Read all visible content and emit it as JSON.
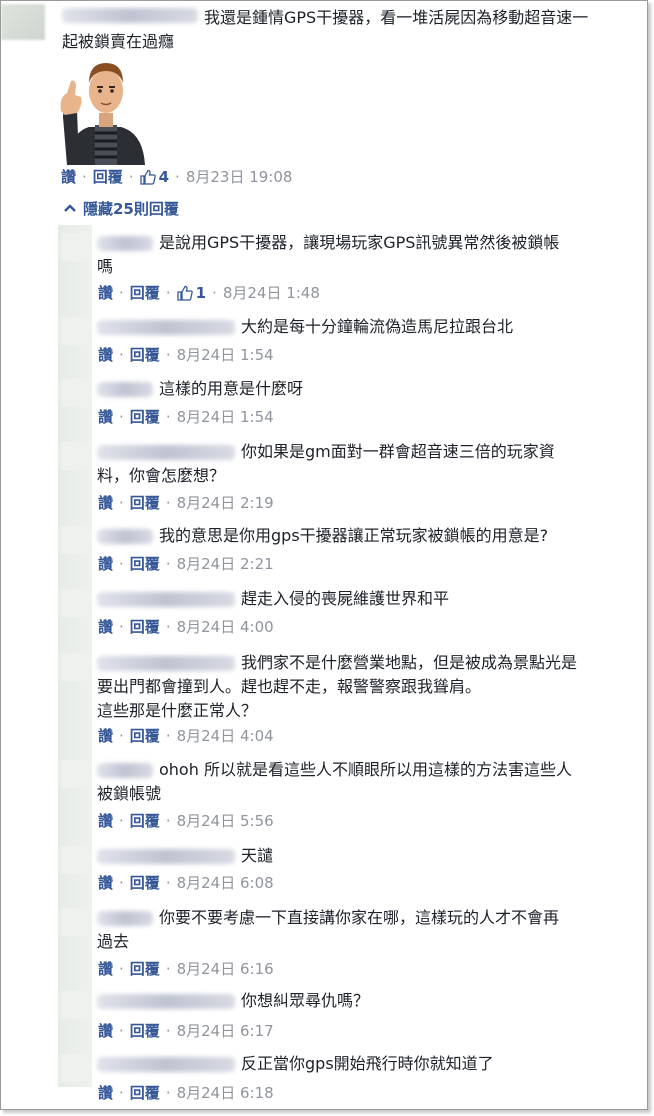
{
  "thread": {
    "top_comment": {
      "author": "Sheng-Lih Wang",
      "text_line1": "我還是鍾情GPS干擾器，看一堆活屍因為移動超音速一",
      "text_line2": "起被鎖賣在過癮",
      "actions": {
        "like": "讚",
        "reply": "回覆",
        "likes": "4",
        "time": "8月23日 19:08"
      }
    },
    "hide_replies_label": "隱藏25則回覆",
    "replies": [
      {
        "author": "Sheng",
        "lines": [
          "是說用GPS干擾器，讓現場玩家GPS訊號異常然後被鎖帳",
          "嗎"
        ],
        "likes": "1",
        "time": "8月24日 1:48"
      },
      {
        "author": "Sheng-Lih Wang",
        "lines": [
          "大約是每十分鐘輪流偽造馬尼拉跟台北"
        ],
        "likes": "",
        "time": "8月24日 1:54"
      },
      {
        "author": "Sheng",
        "lines": [
          "這樣的用意是什麼呀"
        ],
        "likes": "",
        "time": "8月24日 1:54"
      },
      {
        "author": "Sheng-Lih Wang",
        "lines": [
          "你如果是gm面對一群會超音速三倍的玩家資",
          "料，你會怎麼想？"
        ],
        "likes": "",
        "time": "8月24日 2:19"
      },
      {
        "author": "Sheng",
        "lines": [
          "我的意思是你用gps干擾器讓正常玩家被鎖帳的用意是?"
        ],
        "likes": "",
        "time": "8月24日 2:21"
      },
      {
        "author": "Sheng-Lih Wang",
        "lines": [
          "趕走入侵的喪屍維護世界和平"
        ],
        "likes": "",
        "time": "8月24日 4:00"
      },
      {
        "author": "Sheng-Lih Wang",
        "lines": [
          "我們家不是什麼營業地點，但是被成為景點光是",
          "要出門都會撞到人。趕也趕不走，報警警察跟我聳肩。",
          "這些那是什麼正常人？"
        ],
        "likes": "",
        "time": "8月24日 4:04"
      },
      {
        "author": "Sheng",
        "lines": [
          "ohoh 所以就是看這些人不順眼所以用這樣的方法害這些人",
          "被鎖帳號"
        ],
        "likes": "",
        "time": "8月24日 5:56"
      },
      {
        "author": "Sheng-Lih Wang",
        "lines": [
          "天譴"
        ],
        "likes": "",
        "time": "8月24日 6:08"
      },
      {
        "author": "Sheng",
        "lines": [
          "你要不要考慮一下直接講你家在哪，這樣玩的人才不會再",
          "過去"
        ],
        "likes": "",
        "time": "8月24日 6:16"
      },
      {
        "author": "Sheng-Lih Wang",
        "lines": [
          "你想糾眾尋仇嗎？"
        ],
        "likes": "",
        "time": "8月24日 6:17"
      },
      {
        "author": "Sheng-Lih Wang",
        "lines": [
          "反正當你gps開始飛行時你就知道了"
        ],
        "likes": "",
        "time": "8月24日 6:18"
      }
    ]
  },
  "colors": {
    "link": "#365899",
    "text": "#1d2129",
    "meta": "#90949c"
  },
  "icons": {
    "like": "thumbs-up-icon",
    "collapse": "chevron-up-icon",
    "sticker": "thumbs-up-agent-sticker"
  }
}
